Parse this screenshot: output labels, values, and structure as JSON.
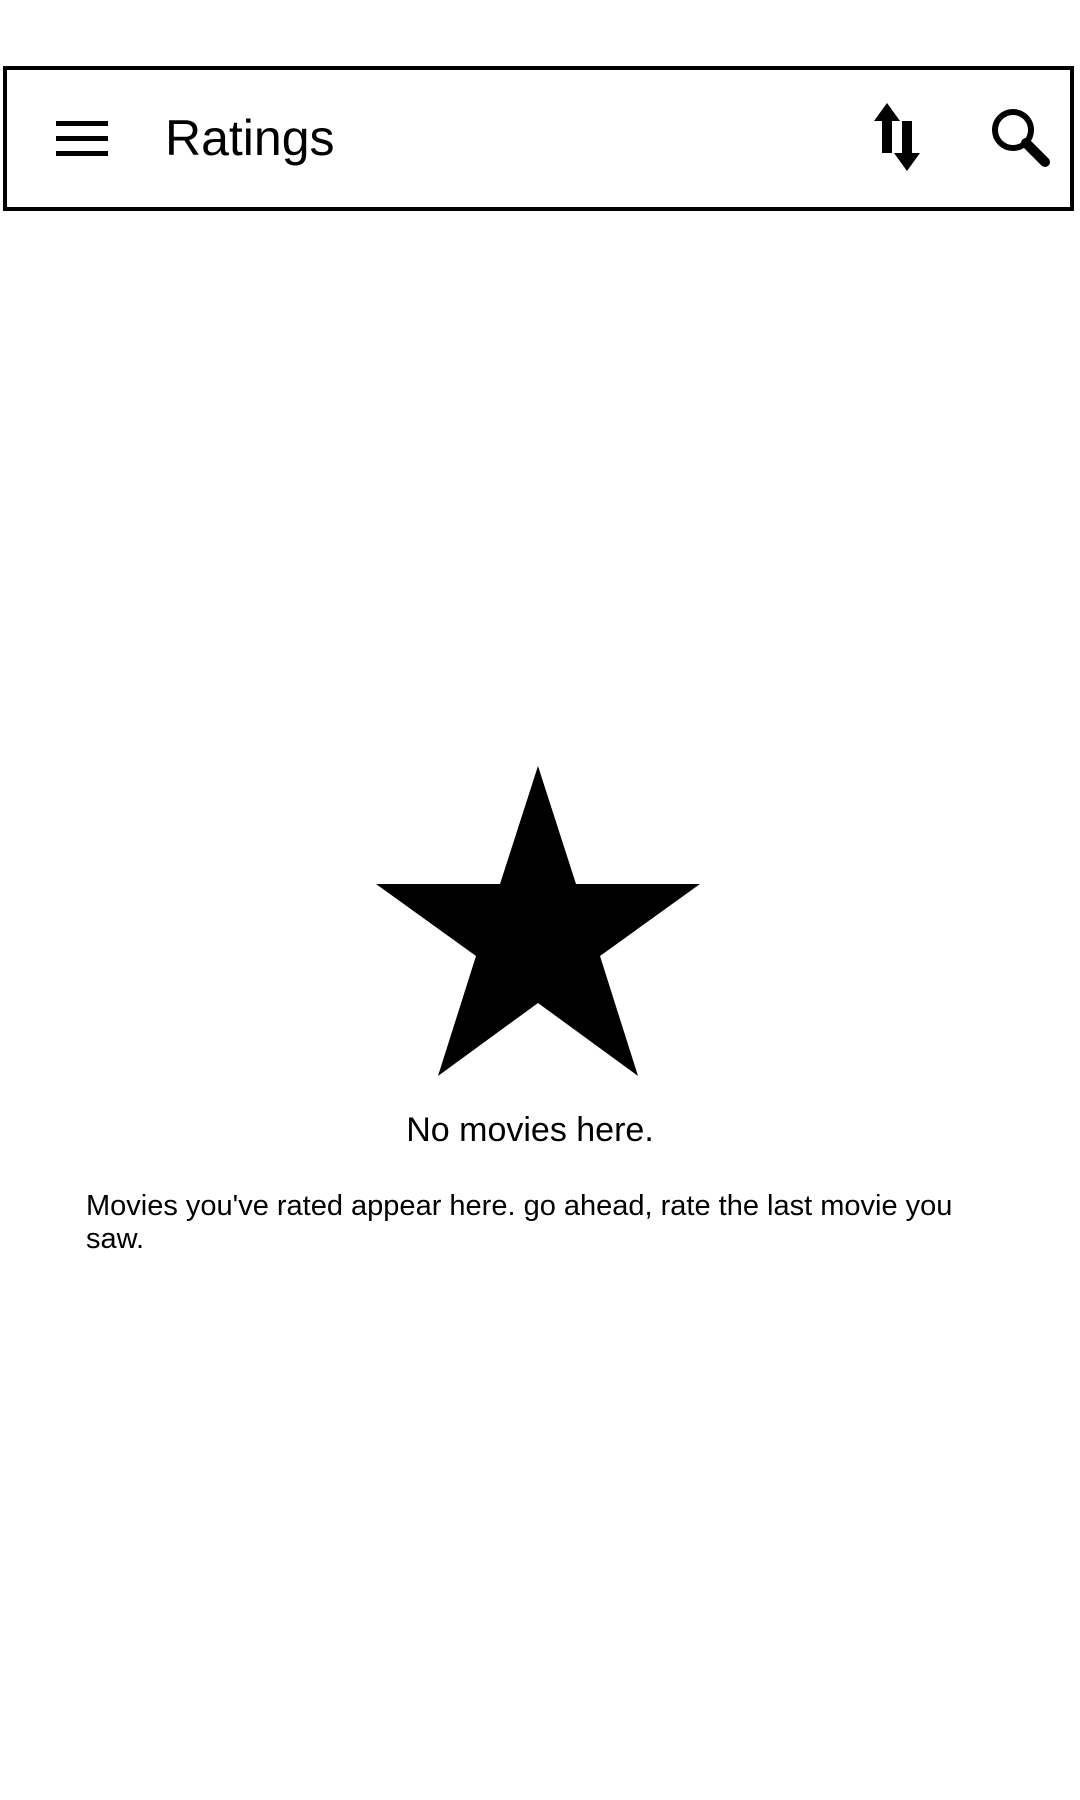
{
  "toolbar": {
    "title": "Ratings",
    "menu_icon": "hamburger-menu-icon",
    "sort_icon": "sort-arrows-icon",
    "search_icon": "search-icon"
  },
  "empty_state": {
    "icon": "star-icon",
    "title": "No movies here.",
    "description": "Movies you've rated appear here. go ahead, rate the last movie you saw."
  },
  "colors": {
    "foreground": "#000000",
    "background": "#ffffff"
  }
}
